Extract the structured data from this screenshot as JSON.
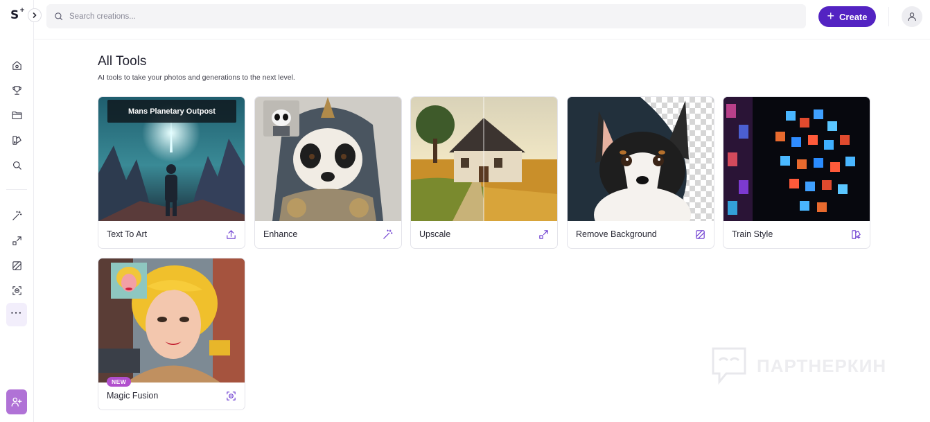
{
  "brand": {
    "logo": "S",
    "logo_mark": "+"
  },
  "search": {
    "placeholder": "Search creations..."
  },
  "header": {
    "create_label": "Create"
  },
  "page": {
    "title": "All Tools",
    "subtitle": "AI tools to take your photos and generations to the next level."
  },
  "sidebar": {
    "items": [
      {
        "icon": "home-icon"
      },
      {
        "icon": "trophy-icon"
      },
      {
        "icon": "folder-icon"
      },
      {
        "icon": "styles-icon"
      },
      {
        "icon": "search-icon"
      },
      {
        "icon": "magic-wand-icon"
      },
      {
        "icon": "upscale-icon"
      },
      {
        "icon": "remove-background-icon"
      },
      {
        "icon": "magic-fusion-icon"
      },
      {
        "icon": "more-icon",
        "label": "···"
      }
    ],
    "invite_icon": "add-user-icon"
  },
  "tools": [
    {
      "label": "Text To Art",
      "icon": "upload-icon",
      "caption": "Mans Planetary Outpost"
    },
    {
      "label": "Enhance",
      "icon": "magic-wand-icon"
    },
    {
      "label": "Upscale",
      "icon": "upscale-icon"
    },
    {
      "label": "Remove Background",
      "icon": "remove-background-icon"
    },
    {
      "label": "Train Style",
      "icon": "train-style-icon"
    },
    {
      "label": "Magic Fusion",
      "icon": "magic-fusion-icon",
      "badge": "NEW"
    }
  ],
  "watermark": {
    "text": "ПАРТНЕРКИН"
  },
  "colors": {
    "accent": "#5323c2",
    "icon": "#6c3bd0",
    "badge": "#b14fcd",
    "invite": "#b072d6"
  }
}
